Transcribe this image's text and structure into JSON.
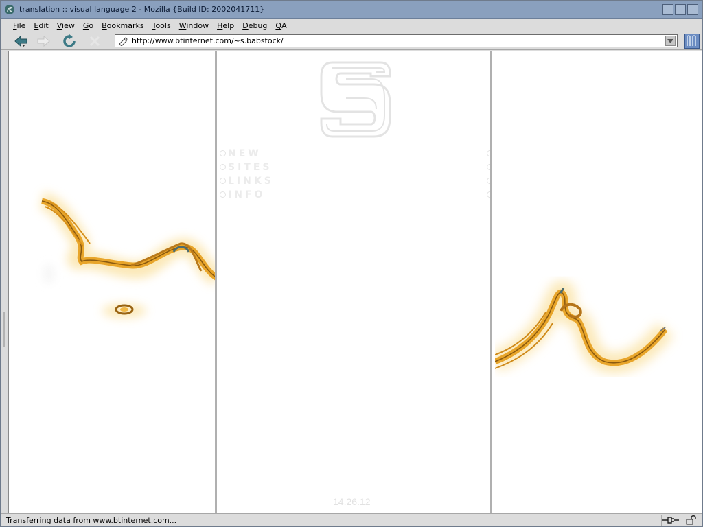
{
  "window": {
    "title": "translation :: visual language 2 - Mozilla {Build ID: 2002041711}"
  },
  "menu": [
    {
      "label": "File",
      "underline": "F",
      "rest": "ile"
    },
    {
      "label": "Edit",
      "underline": "E",
      "rest": "dit"
    },
    {
      "label": "View",
      "underline": "V",
      "rest": "iew"
    },
    {
      "label": "Go",
      "underline": "G",
      "rest": "o"
    },
    {
      "label": "Bookmarks",
      "underline": "B",
      "rest": "ookmarks"
    },
    {
      "label": "Tools",
      "underline": "T",
      "rest": "ools"
    },
    {
      "label": "Window",
      "underline": "W",
      "rest": "indow"
    },
    {
      "label": "Help",
      "underline": "H",
      "rest": "elp"
    },
    {
      "label": "Debug",
      "underline": "D",
      "rest": "ebug"
    },
    {
      "label": "QA",
      "underline": "Q",
      "rest": "A"
    }
  ],
  "toolbar": {
    "back": "back-icon",
    "forward": "forward-icon",
    "reload": "reload-icon",
    "stop": "stop-icon"
  },
  "urlbar": {
    "value": "http://www.btinternet.com/~s.babstock/"
  },
  "page": {
    "nav_links": [
      "NEW",
      "SITES",
      "LINKS",
      "INFO"
    ],
    "date": "14.26.12"
  },
  "status": {
    "text": "Transferring data from www.btinternet.com..."
  },
  "colors": {
    "titlebar": "#8aa0be",
    "chrome": "#dcdcdc",
    "stroke_orange": "#e8a52a",
    "stroke_dark": "#8a5a10",
    "glow": "#fbe8b8",
    "ghost_text": "#ebebeb"
  }
}
